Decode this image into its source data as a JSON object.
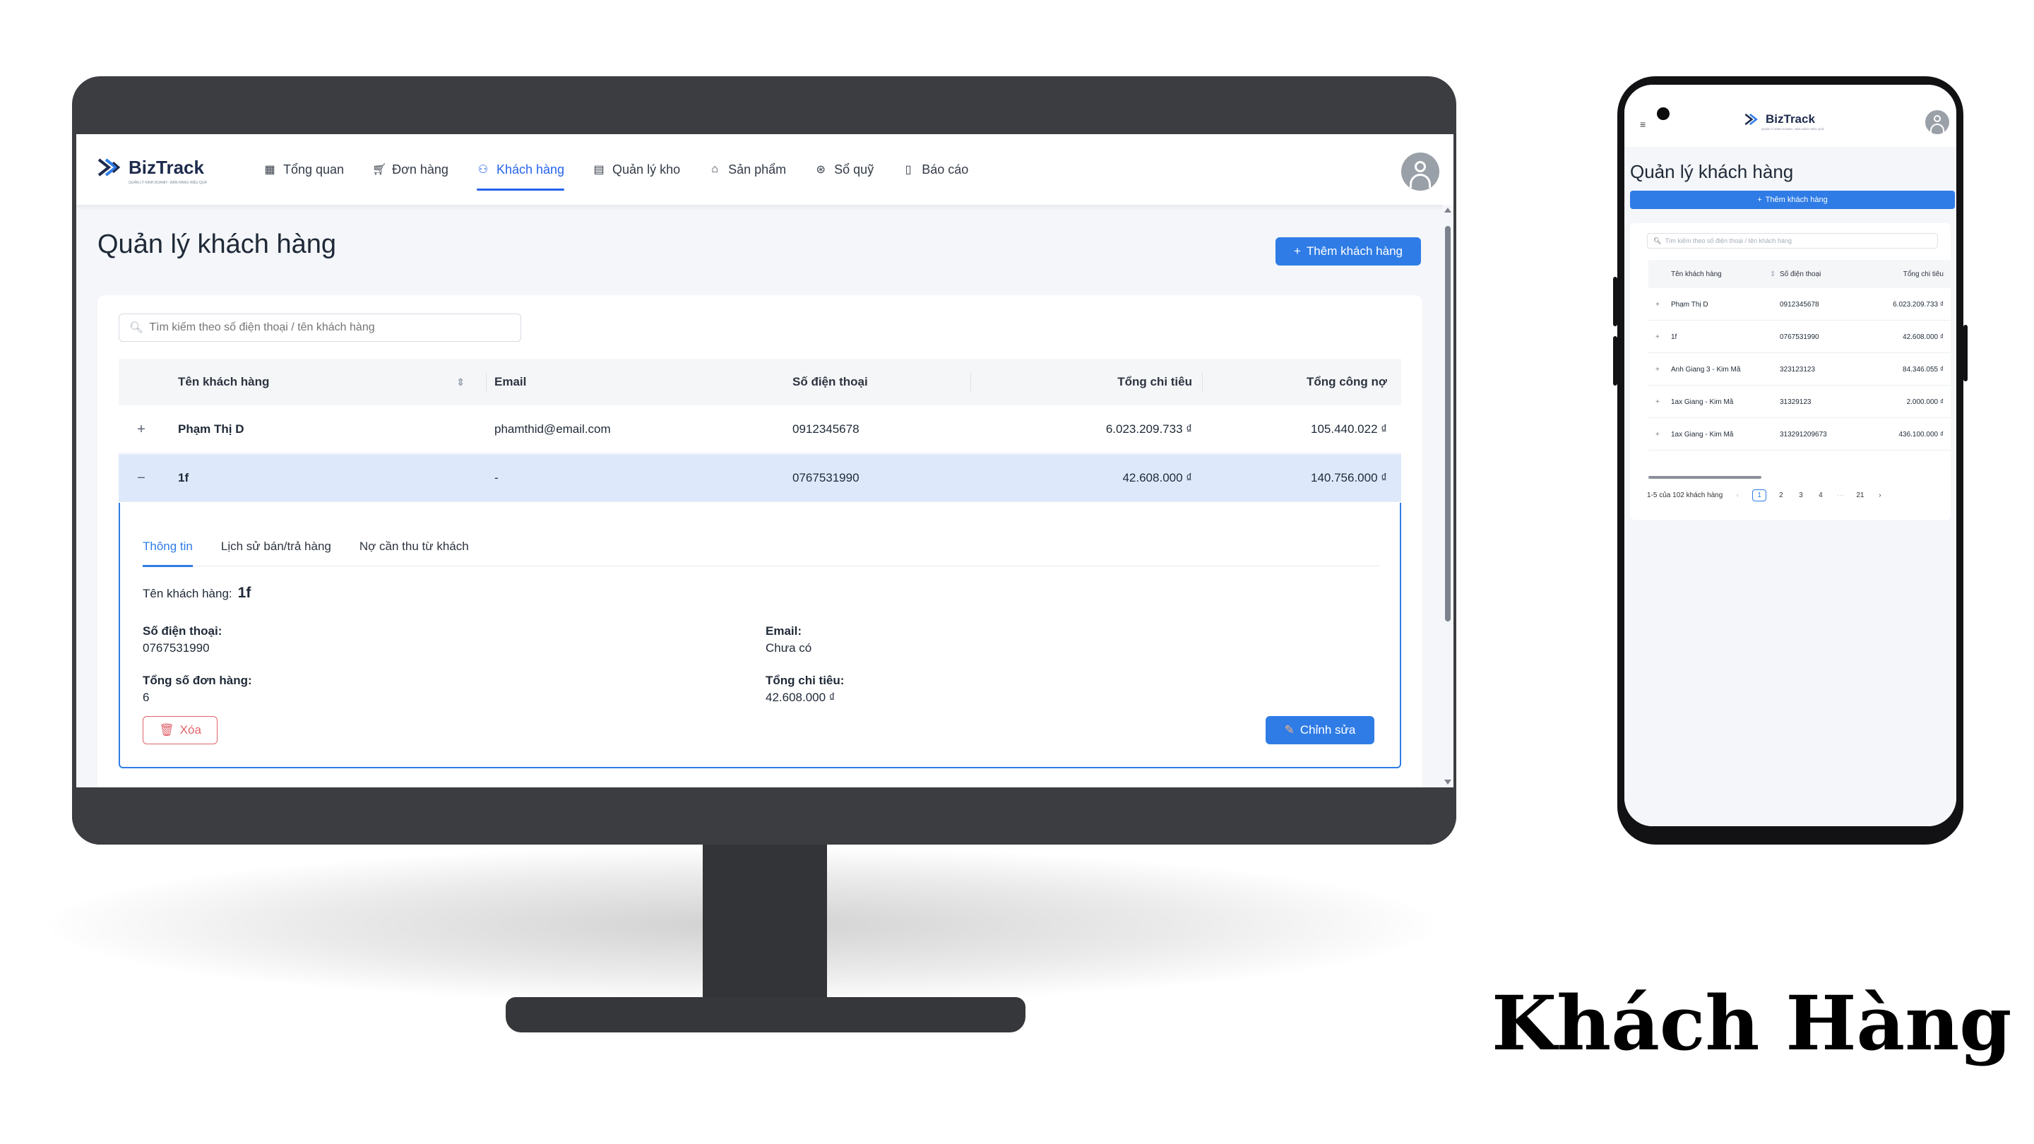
{
  "brand": {
    "name": "BizTrack",
    "tagline": "QUẢN LÝ KINH DOANH - BÁN HÀNG HIỆU QUẢ",
    "accent": "#2f7ce6"
  },
  "nav": [
    {
      "label": "Tổng quan",
      "icon": "dashboard-icon"
    },
    {
      "label": "Đơn hàng",
      "icon": "cart-icon"
    },
    {
      "label": "Khách hàng",
      "icon": "user-icon",
      "active": true
    },
    {
      "label": "Quản lý kho",
      "icon": "warehouse-icon"
    },
    {
      "label": "Sản phẩm",
      "icon": "bag-icon"
    },
    {
      "label": "Sổ quỹ",
      "icon": "coin-icon"
    },
    {
      "label": "Báo cáo",
      "icon": "report-icon"
    }
  ],
  "page": {
    "title": "Quản lý khách hàng",
    "add_button": "Thêm khách hàng",
    "search_placeholder": "Tìm kiếm theo số điện thoại / tên khách hàng"
  },
  "table": {
    "columns": [
      "Tên khách hàng",
      "Email",
      "Số điện thoại",
      "Tổng chi tiêu",
      "Tổng công nợ"
    ],
    "rows": [
      {
        "expander": "+",
        "name": "Phạm Thị D",
        "email": "phamthid@email.com",
        "phone": "0912345678",
        "spend": "6.023.209.733 ₫",
        "debt": "105.440.022 ₫"
      },
      {
        "expander": "−",
        "name": "1f",
        "email": "-",
        "phone": "0767531990",
        "spend": "42.608.000 ₫",
        "debt": "140.756.000 ₫"
      }
    ]
  },
  "detail": {
    "tabs": [
      "Thông tin",
      "Lịch sử bán/trả hàng",
      "Nợ cần thu từ khách"
    ],
    "name_label": "Tên khách hàng:",
    "name_value": "1f",
    "phone_label": "Số điện thoại:",
    "phone_value": "0767531990",
    "email_label": "Email:",
    "email_value": "Chưa có",
    "orders_label": "Tổng số đơn hàng:",
    "orders_value": "6",
    "spend_label": "Tổng chi tiêu:",
    "spend_value": "42.608.000 ₫",
    "delete_button": "Xóa",
    "edit_button": "Chỉnh sửa"
  },
  "mobile": {
    "title": "Quản lý khách hàng",
    "add_button": "Thêm khách hàng",
    "search_placeholder": "Tìm kiếm theo số điện thoại / tên khách hàng",
    "columns": [
      "Tên khách hàng",
      "Số điện thoại",
      "Tổng chi tiêu"
    ],
    "rows": [
      {
        "name": "Phạm Thị D",
        "phone": "0912345678",
        "spend": "6.023.209.733 ₫"
      },
      {
        "name": "1f",
        "phone": "0767531990",
        "spend": "42.608.000 ₫"
      },
      {
        "name": "Anh Giang 3 - Kim Mã",
        "phone": "323123123",
        "spend": "84.346.055 ₫"
      },
      {
        "name": "1ax Giang - Kim Mã",
        "phone": "31329123",
        "spend": "2.000.000 ₫"
      },
      {
        "name": "1ax Giang - Kim Mã",
        "phone": "313291209673",
        "spend": "436.100.000 ₫"
      }
    ],
    "pager_summary": "1-5 của 102 khách hàng",
    "pages": [
      "1",
      "2",
      "3",
      "4",
      "···",
      "21"
    ]
  },
  "caption": "Khách Hàng"
}
